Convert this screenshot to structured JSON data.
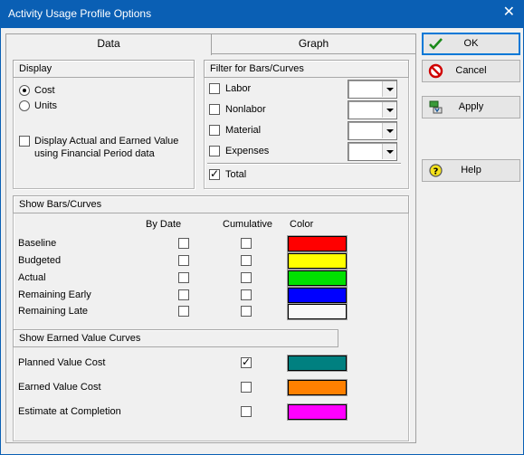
{
  "window": {
    "title": "Activity Usage Profile Options",
    "close_glyph": "✕"
  },
  "tabs": [
    {
      "label": "Data"
    },
    {
      "label": "Graph"
    }
  ],
  "display": {
    "heading": "Display",
    "radio_cost": "Cost",
    "radio_units": "Units",
    "selected": "Cost",
    "financial_line1": "Display Actual and Earned Value",
    "financial_line2": "using Financial Period data"
  },
  "filter": {
    "heading": "Filter for Bars/Curves",
    "labor": "Labor",
    "nonlabor": "Nonlabor",
    "material": "Material",
    "expenses": "Expenses",
    "total": "Total"
  },
  "bars": {
    "heading": "Show Bars/Curves",
    "col_by_date": "By Date",
    "col_cumulative": "Cumulative",
    "col_color": "Color",
    "rows": [
      {
        "label": "Baseline",
        "color": "#ff0000"
      },
      {
        "label": "Budgeted",
        "color": "#ffff00"
      },
      {
        "label": "Actual",
        "color": "#00e000"
      },
      {
        "label": "Remaining Early",
        "color": "#0000ff"
      },
      {
        "label": "Remaining Late",
        "color": "#f8f8f8"
      }
    ]
  },
  "earned": {
    "heading": "Show Earned Value Curves",
    "rows": [
      {
        "label": "Planned Value Cost",
        "color": "#008080",
        "checked": true
      },
      {
        "label": "Earned Value Cost",
        "color": "#ff8000",
        "checked": false
      },
      {
        "label": "Estimate at Completion",
        "color": "#ff00ff",
        "checked": false
      }
    ]
  },
  "buttons": {
    "ok": "OK",
    "cancel": "Cancel",
    "apply": "Apply",
    "help": "Help"
  }
}
